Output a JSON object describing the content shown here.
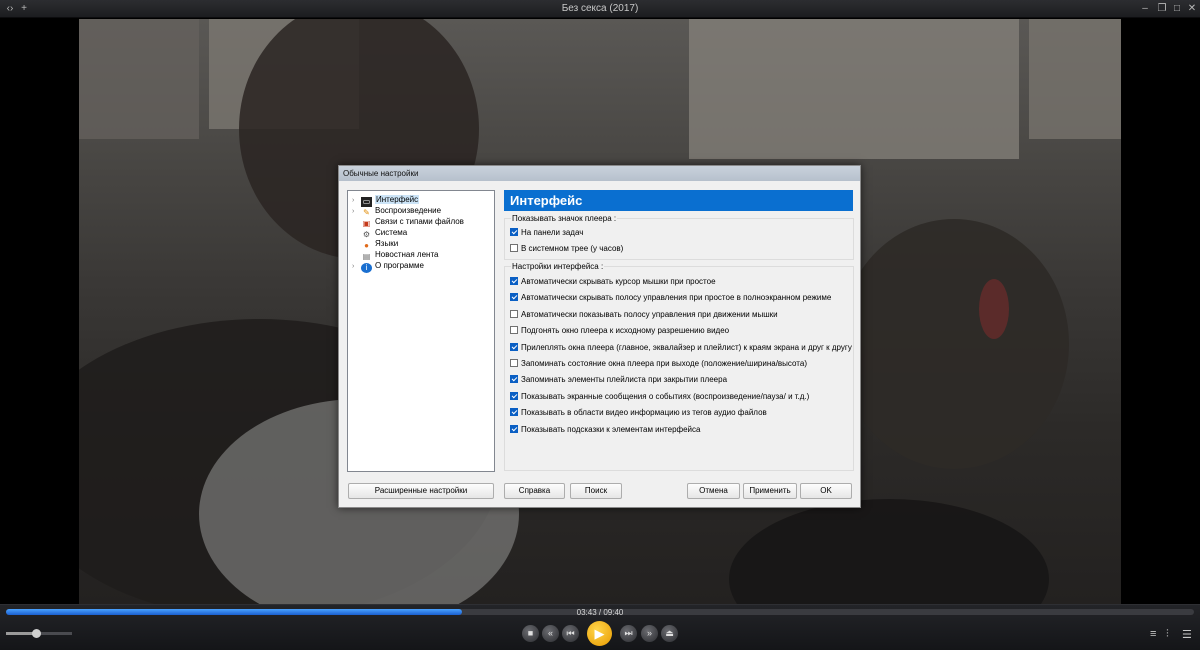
{
  "window": {
    "title": "Без секса (2017)",
    "left_icons": [
      "menu-icon",
      "plus-icon"
    ],
    "right_icons": [
      "minimize-icon",
      "restore-icon",
      "maximize-icon",
      "close-icon"
    ]
  },
  "playback": {
    "time_text": "03:43 / 09:40",
    "progress_fraction": 0.384,
    "volume_fraction": 0.45
  },
  "controls": {
    "buttons": [
      "stop-icon",
      "rewind-icon",
      "previous-icon",
      "play-icon",
      "next-icon",
      "fast-forward-icon",
      "open-icon"
    ],
    "right_icons": [
      "playlist-icon",
      "equalizer-icon",
      "settings-icon"
    ]
  },
  "dialog": {
    "title": "Обычные настройки",
    "tree": [
      {
        "label": "Интерфейс",
        "icon": "monitor-icon",
        "selected": true,
        "expandable": true
      },
      {
        "label": "Воспроизведение",
        "icon": "film-icon",
        "selected": false,
        "expandable": true
      },
      {
        "label": "Связи с типами файлов",
        "icon": "file-associations-icon",
        "selected": false,
        "expandable": false
      },
      {
        "label": "Система",
        "icon": "system-gear-icon",
        "selected": false,
        "expandable": false
      },
      {
        "label": "Языки",
        "icon": "languages-icon",
        "selected": false,
        "expandable": false
      },
      {
        "label": "Новостная лента",
        "icon": "news-feed-icon",
        "selected": false,
        "expandable": false
      },
      {
        "label": "О программе",
        "icon": "info-icon",
        "selected": false,
        "expandable": true
      }
    ],
    "panel_title": "Интерфейс",
    "group1": {
      "title": "Показывать значок плеера :",
      "options": [
        {
          "label": "На панели задач",
          "checked": true
        },
        {
          "label": "В системном трее (у часов)",
          "checked": false
        }
      ]
    },
    "group2": {
      "title": "Настройки интерфейса :",
      "options": [
        {
          "label": "Автоматически скрывать курсор мышки при простое",
          "checked": true
        },
        {
          "label": "Автоматически скрывать полосу управления при простое в полноэкранном режиме",
          "checked": true
        },
        {
          "label": "Автоматически показывать полосу управления при движении мышки",
          "checked": false
        },
        {
          "label": "Подгонять окно плеера к исходному разрешению видео",
          "checked": false
        },
        {
          "label": "Прилеплять окна плеера (главное, эквалайзер и плейлист) к краям экрана и друг к другу",
          "checked": true
        },
        {
          "label": "Запоминать состояние окна плеера при выходе (положение/ширина/высота)",
          "checked": false
        },
        {
          "label": "Запоминать элементы плейлиста при закрытии плеера",
          "checked": true
        },
        {
          "label": "Показывать экранные сообщения о событиях (воспроизведение/пауза/ и т.д.)",
          "checked": true
        },
        {
          "label": "Показывать в области видео информацию из тегов аудио файлов",
          "checked": true
        },
        {
          "label": "Показывать подсказки к элементам интерфейса",
          "checked": true
        }
      ]
    },
    "buttons": {
      "advanced": "Расширенные настройки",
      "help": "Справка",
      "search": "Поиск",
      "cancel": "Отмена",
      "apply": "Применить",
      "ok": "OK"
    }
  }
}
